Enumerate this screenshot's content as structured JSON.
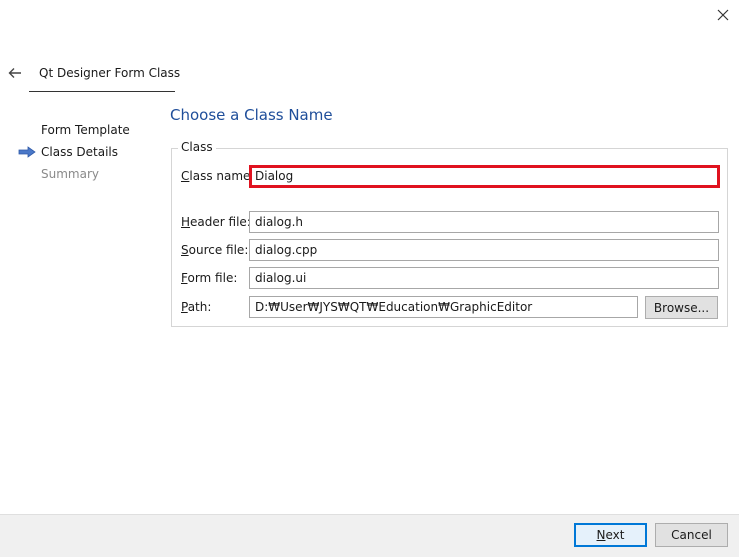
{
  "window": {
    "close_icon": "close-icon"
  },
  "header": {
    "back_icon": "back-arrow-icon",
    "title": "Qt Designer Form Class"
  },
  "heading": "Choose a Class Name",
  "steps": [
    {
      "label": "Form Template",
      "state": "done"
    },
    {
      "label": "Class Details",
      "state": "current"
    },
    {
      "label": "Summary",
      "state": "future"
    }
  ],
  "group": {
    "title": "Class",
    "class_name": {
      "mnemonic": "C",
      "rest": "lass name:",
      "value": "Dialog"
    },
    "header_file": {
      "mnemonic": "H",
      "rest": "eader file:",
      "value": "dialog.h"
    },
    "source_file": {
      "mnemonic": "S",
      "rest": "ource file:",
      "value": "dialog.cpp"
    },
    "form_file": {
      "mnemonic": "F",
      "rest": "orm file:",
      "value": "dialog.ui"
    },
    "path": {
      "mnemonic": "P",
      "rest": "ath:",
      "value": "D:₩User₩JYS₩QT₩Education₩GraphicEditor"
    },
    "browse_label": "Browse..."
  },
  "footer": {
    "next": {
      "mnemonic": "N",
      "rest": "ext"
    },
    "cancel": "Cancel"
  },
  "colors": {
    "heading": "#1f4e9a",
    "highlight": "#e0121f",
    "current_arrow": "#4a78c8"
  }
}
